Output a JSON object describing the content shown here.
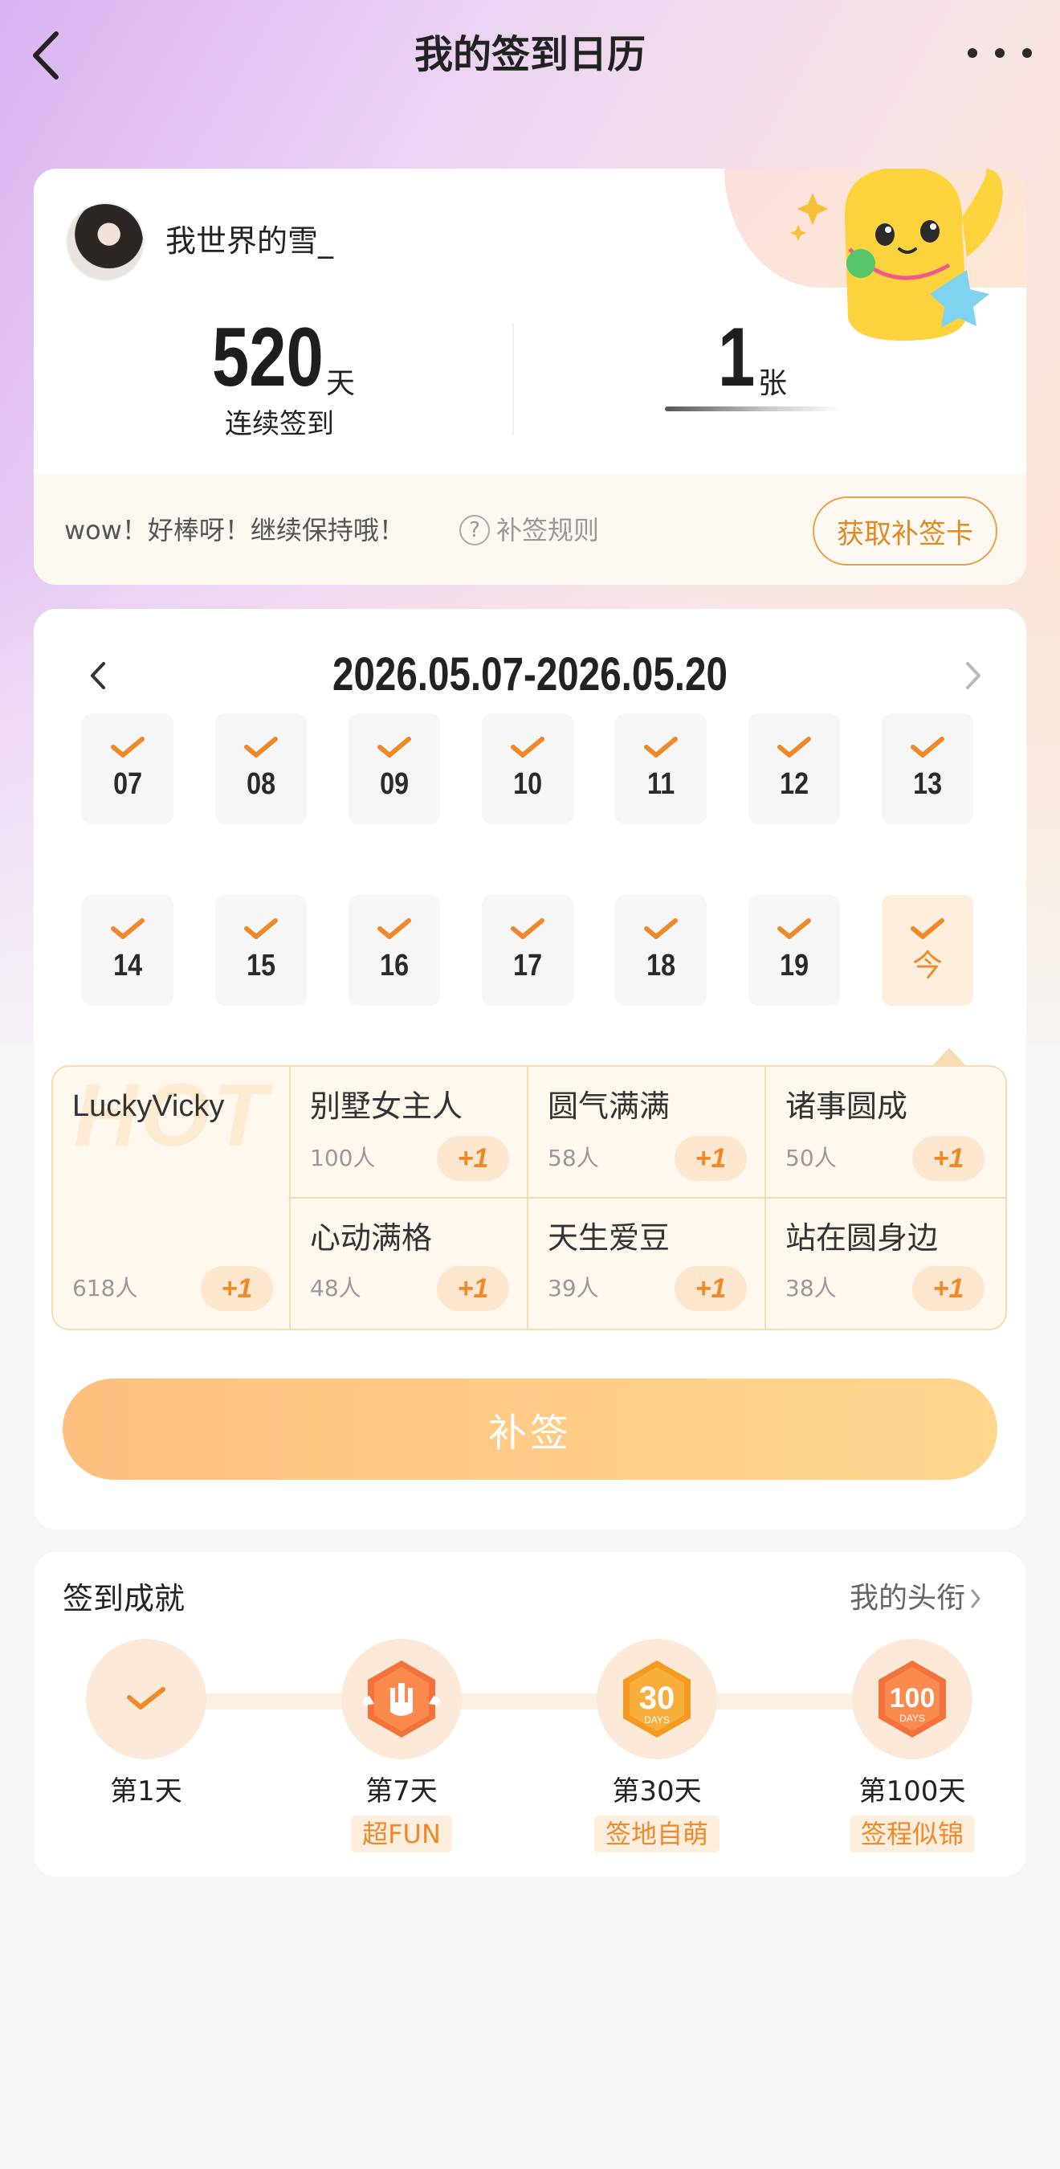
{
  "header": {
    "title": "我的签到日历"
  },
  "profile": {
    "username": "我世界的雪_",
    "streak_value": "520",
    "streak_unit": "天",
    "streak_label": "连续签到",
    "cards_value": "1",
    "cards_unit": "张",
    "encourage_text": "wow！好棒呀！继续保持哦！",
    "rule_icon": "?",
    "rule_label": "补签规则",
    "get_card_label": "获取补签卡"
  },
  "calendar": {
    "range": "2026.05.07-2026.05.20",
    "days": [
      "07",
      "08",
      "09",
      "10",
      "11",
      "12",
      "13",
      "14",
      "15",
      "16",
      "17",
      "18",
      "19",
      "今"
    ],
    "signed": [
      true,
      true,
      true,
      true,
      true,
      true,
      true,
      true,
      true,
      true,
      true,
      true,
      true,
      true
    ],
    "today_index": 13
  },
  "titles": {
    "featured": {
      "name": "LuckyVicky",
      "count": "618人",
      "plus": "+1",
      "watermark": "HOT"
    },
    "items": [
      {
        "name": "别墅女主人",
        "count": "100人",
        "plus": "+1"
      },
      {
        "name": "圆气满满",
        "count": "58人",
        "plus": "+1"
      },
      {
        "name": "诸事圆成",
        "count": "50人",
        "plus": "+1"
      },
      {
        "name": "心动满格",
        "count": "48人",
        "plus": "+1"
      },
      {
        "name": "天生爱豆",
        "count": "39人",
        "plus": "+1"
      },
      {
        "name": "站在圆身边",
        "count": "38人",
        "plus": "+1"
      }
    ]
  },
  "resign_button": "补签",
  "achievements": {
    "title": "签到成就",
    "link": "我的头衔",
    "items": [
      {
        "day": "第1天",
        "tag": "",
        "icon": "check-icon"
      },
      {
        "day": "第7天",
        "tag": "超FUN",
        "icon": "fun-hand-badge-icon"
      },
      {
        "day": "第30天",
        "tag": "签地自萌",
        "icon": "30-days-badge-icon"
      },
      {
        "day": "第100天",
        "tag": "签程似锦",
        "icon": "100-days-badge-icon"
      }
    ],
    "badge_30_text": "30",
    "badge_100_text": "100",
    "badge_days_text": "DAYS"
  },
  "colors": {
    "accent": "#ef8a2a",
    "button_gradient_start": "#ffbf7e",
    "button_gradient_end": "#ffd78f"
  }
}
